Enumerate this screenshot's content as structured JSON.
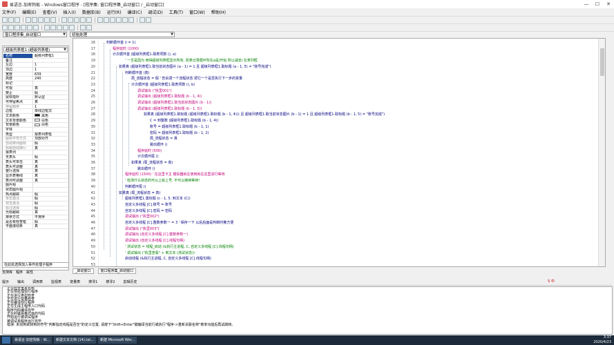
{
  "window": {
    "title": "易语言-加密狗板 - Windows窗口程序 - [程序集: 窗口程序集_启动窗口 / _启动窗口]",
    "controls": [
      "—",
      "☐",
      "✕"
    ]
  },
  "menu": [
    "文件(F)",
    "编辑(E)",
    "查看(V)",
    "插入(I)",
    "数据库(B)",
    "运行(R)",
    "编译(C)",
    "调试(D)",
    "工具(T)",
    "窗口(W)",
    "帮助(H)"
  ],
  "combos": {
    "assembly": "窗口程序集_启动窗口",
    "subroutine": "初始处理"
  },
  "left_panel": {
    "component_combo": "超级列表框1 (超级列表框)",
    "properties": [
      {
        "name": "名称",
        "value": "超级列表框1",
        "hl": true
      },
      {
        "name": "备注",
        "value": ""
      },
      {
        "name": "左边",
        "value": "1"
      },
      {
        "name": "顶边",
        "value": "1"
      },
      {
        "name": "宽度",
        "value": "639"
      },
      {
        "name": "高度",
        "value": "240"
      },
      {
        "name": "标记",
        "value": ""
      },
      {
        "name": "可视",
        "value": "真"
      },
      {
        "name": "禁止",
        "value": "假"
      },
      {
        "name": "鼠标指针",
        "value": "默认型"
      },
      {
        "name": "可停留焦点",
        "value": "真"
      },
      {
        "name": "停留顺序",
        "value": "1",
        "gray": true
      },
      {
        "name": "边框",
        "value": "单线边框式"
      },
      {
        "name": "文本颜色",
        "value": "黑色",
        "swatch": "#000000"
      },
      {
        "name": "文本背景颜色",
        "value": "白色",
        "swatch": "#ffffff"
      },
      {
        "name": "背景颜色",
        "value": "白色",
        "swatch": "#ffffff"
      },
      {
        "name": "字体",
        "value": ""
      },
      {
        "name": "类型",
        "value": "报表列表框"
      },
      {
        "name": "图标字符方式",
        "value": "顶部对齐",
        "gray": true
      },
      {
        "name": "自动排列图标",
        "value": "假",
        "gray": true
      },
      {
        "name": "标题自动换行",
        "value": "真",
        "gray": true
      },
      {
        "name": "报表列",
        "value": ""
      },
      {
        "name": "无表头",
        "value": "假"
      },
      {
        "name": "表头可单击",
        "value": "真"
      },
      {
        "name": "表头可调整",
        "value": "真"
      },
      {
        "name": "整行选择",
        "value": "真"
      },
      {
        "name": "显示表格线",
        "value": "真"
      },
      {
        "name": "表列可调整",
        "value": "真"
      },
      {
        "name": "图片组",
        "value": ""
      },
      {
        "name": "状态图片组",
        "value": ""
      },
      {
        "name": "热点跟踪",
        "value": "假"
      },
      {
        "name": "单击激活",
        "value": "假",
        "gray": true
      },
      {
        "name": "双击激活",
        "value": "假",
        "gray": true
      },
      {
        "name": "标注选择",
        "value": "假",
        "gray": true
      },
      {
        "name": "光标跟踪",
        "value": "真"
      },
      {
        "name": "排序方式",
        "value": "不排序"
      },
      {
        "name": "是否有检查框",
        "value": "假"
      },
      {
        "name": "平面滚动条",
        "value": "真"
      }
    ],
    "tip": "在此处选择加入事件处理子程序",
    "tabs": [
      "支持库",
      "程序",
      "属性"
    ]
  },
  "editor": {
    "lines": [
      {
        "n": "16",
        "indent": 0,
        "cls": "fn",
        "text": "判断循环首 (i = 1)"
      },
      {
        "n": "17",
        "indent": 1,
        "cls": "pink",
        "text": "程序延时 (1000)"
      },
      {
        "n": "18",
        "indent": 1,
        "cls": "fn",
        "text": "计次循环首 (超级列表框1.取表项数 (), a)"
      },
      {
        "n": "19",
        "indent": 3,
        "cls": "cmt",
        "text": "' 一旦是因为 用得超级列表框显示所有, 而表记录循环所在a是i开始 所以减去i 在表列框"
      },
      {
        "n": "20",
        "indent": 2,
        "cls": "fn",
        "text": "如果真 (超级列表框1.取当前状态图片 (a - 1) = 1 且 超级列表框1.取标题 (a - 1, 5) ≠ \"账号完成\")"
      },
      {
        "n": "21",
        "indent": 3,
        "cls": "fn",
        "text": "判断循环首 (真)"
      },
      {
        "n": "22",
        "indent": 4,
        "cls": "fn",
        "text": "局_流程状态 = 假  ' 告诉调一个流程状态 把它一个是否执行下一步的变量"
      },
      {
        "n": "23",
        "indent": 4,
        "cls": "fn",
        "text": "计次循环首 (超级列表框1.取表项数 (), b)"
      },
      {
        "n": "24",
        "indent": 5,
        "cls": "pink",
        "text": "调试输出 (\"执里001\")"
      },
      {
        "n": "25",
        "indent": 5,
        "cls": "pink",
        "text": "调试输出 (超级列表框1.取标题 (b - 1, 4))"
      },
      {
        "n": "26",
        "indent": 5,
        "cls": "pink",
        "text": "调试输出 (超级列表框1.取当前状态图片 (b - 1))"
      },
      {
        "n": "27",
        "indent": 5,
        "cls": "pink",
        "text": "调试输出 (超级列表框1.取标题 (b - 1, 5))"
      },
      {
        "n": "28",
        "indent": 6,
        "cls": "fn",
        "text": "如果真 (超级列表框1.取标题 (超级列表框1.取标题 (b - 1, 4))) 且 超级列表框1.取当前状态图片 (b - 1) = 1 且 超级列表框1.取标题 (b - 1, 5) ≠ \"账号完成\")"
      },
      {
        "n": "29",
        "indent": 7,
        "cls": "fn",
        "text": "C = 到整数 (超级列表框1.取标题 (b - 1, 4))"
      },
      {
        "n": "30",
        "indent": 7,
        "cls": "fn",
        "text": "账号 = 超级列表框1.取标题 (b - 1, 1)"
      },
      {
        "n": "31",
        "indent": 7,
        "cls": "fn",
        "text": "密码 = 超级列表框1.取标题 (b - 1, 2)"
      },
      {
        "n": "32",
        "indent": 7,
        "cls": "fn",
        "text": "局_流程状态 = 真"
      },
      {
        "n": "33",
        "indent": 7,
        "cls": "fn",
        "text": "跳出循环 ()"
      },
      {
        "n": "34",
        "indent": 5,
        "cls": "pink",
        "text": "程序延时 (500)"
      },
      {
        "n": "35",
        "indent": 5,
        "cls": "fn",
        "text": "计次循环尾 ()"
      },
      {
        "n": "36",
        "indent": 4,
        "cls": "fn",
        "text": "如果真 (局_流程状态 = 真)"
      },
      {
        "n": "37",
        "indent": 5,
        "cls": "fn",
        "text": "跳出循环 ()"
      },
      {
        "n": "38",
        "indent": 3,
        "cls": "pink",
        "text": "程序延时 (1500)  ' 在这里卡主 模拟器就在使用就在这里进行等待"
      },
      {
        "n": "39",
        "indent": 3,
        "cls": "cmt",
        "text": "' 检测什么状态的可以上就上号, 不可以继续等待!"
      },
      {
        "n": "40",
        "indent": 3,
        "cls": "fn",
        "text": "判断循环尾 ()"
      },
      {
        "n": "41",
        "indent": 2,
        "cls": "fn",
        "text": "如果真 (局_流程状态 = 真)"
      },
      {
        "n": "42",
        "indent": 3,
        "cls": "fn",
        "text": "超级列表框1.置标题 (c - 1, 5, 到文本 (C))"
      },
      {
        "n": "43",
        "indent": 3,
        "cls": "fn",
        "text": "自定义多线程 [C].账号 = 账号"
      },
      {
        "n": "44",
        "indent": 3,
        "cls": "fn",
        "text": "自定义多线程 [C].密码 = 密码"
      },
      {
        "n": "45",
        "indent": 3,
        "cls": "pink",
        "text": "调试输出 (\"执里002\")"
      },
      {
        "n": "46",
        "indent": 3,
        "cls": "fn",
        "text": "自定义多线程 [C].整数参数一 = 3  ' 保存一下 以后后面是判断时推方便"
      },
      {
        "n": "47",
        "indent": 3,
        "cls": "pink",
        "text": "调试输出 (\"执里003\")"
      },
      {
        "n": "48",
        "indent": 3,
        "cls": "pink",
        "text": "调试输出 (自定义多线程 [C].整数参数一)"
      },
      {
        "n": "49",
        "indent": 3,
        "cls": "pink",
        "text": "调试输出 (自定义多线程 [C].线程句柄)"
      },
      {
        "n": "50",
        "indent": 3,
        "cls": "cmt",
        "text": "' 测试状态 = 线程_启动 (&执行主进程, C, 自定义多线程 [C].线程句柄)"
      },
      {
        "n": "51",
        "indent": 3,
        "cls": "cmt",
        "text": "' 调试输出 (\"执里查看\" + 到文本 (测试状态))"
      },
      {
        "n": "52",
        "indent": 3,
        "cls": "fn",
        "text": "启动线程 (&执行主进程, C, 自定义多线程 [C].线程句柄)"
      },
      {
        "n": "53",
        "indent": 2,
        "cls": "fn",
        "text": ""
      },
      {
        "n": "54",
        "indent": 2,
        "cls": "fn",
        "text": "游戏窗口 = 游戏窗口 + 1  ' 使用一个变量来记录启动的窗口数量"
      }
    ]
  },
  "editor_tabs": [
    "_启动窗口",
    "窗口程序集_启动窗口"
  ],
  "bottom_tabs": [
    "提示",
    "输出",
    "调用表",
    "监视表",
    "变量表",
    "搜寻1",
    "搜寻2",
    "剪辑历史"
  ],
  "output": [
    "正在检查重复名称",
    "正在预处理现行程序",
    "正在进行类型检查",
    "正在进行变量检查",
    "正在编译现行程序",
    "正在生成主程序入口代码",
    "程序代码编译完毕",
    "正在封装易格式目的代码",
    "开始运行被调试程序",
    "被调试易程序运行完毕",
    "错误: 未找到欲转到的符号\"判断指定线程是否空\"的定义位置, 请按下\"Shift+Enter\"键编译当前行或执行\"程序->重新关联名称\"菜单功能后再试跳转。"
  ],
  "taskbar": {
    "tasks": [
      "易语言-加密狗板 - W...",
      "新建文本文档 (14).txt...",
      "新建 Microsoft Wor..."
    ],
    "time": "3:37",
    "date": "2020/4/23"
  },
  "ime": "S 中"
}
